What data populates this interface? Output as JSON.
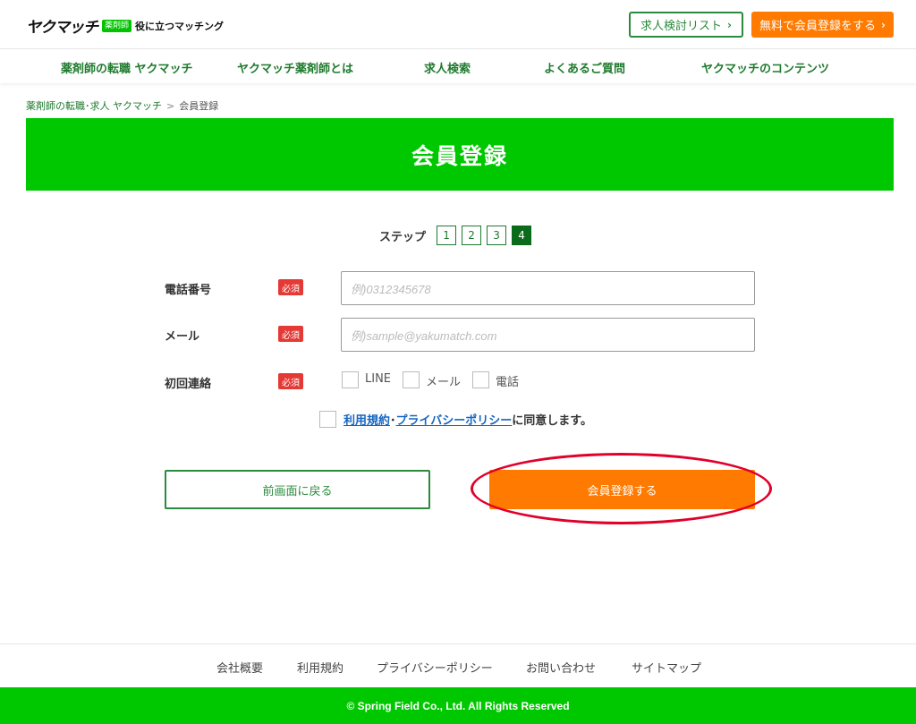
{
  "header": {
    "logo_main": "ヤクマッチ",
    "logo_badge": "薬剤師",
    "logo_tagline": "役に立つマッチング",
    "list_button": "求人検討リスト",
    "register_button": "無料で会員登録をする"
  },
  "nav": {
    "items": [
      {
        "label": "薬剤師の転職 ヤクマッチ"
      },
      {
        "label": "ヤクマッチ薬剤師とは"
      },
      {
        "label": "求人検索"
      },
      {
        "label": "よくあるご質問"
      },
      {
        "label": "ヤクマッチのコンテンツ"
      }
    ]
  },
  "breadcrumb": {
    "home": "薬剤師の転職･求人 ヤクマッチ",
    "separator": ">",
    "current": "会員登録"
  },
  "hero": {
    "title": "会員登録"
  },
  "steps": {
    "label": "ステップ",
    "items": [
      "1",
      "2",
      "3",
      "4"
    ],
    "current": "4"
  },
  "form": {
    "required_badge": "必須",
    "phone": {
      "label": "電話番号",
      "placeholder": "例)0312345678",
      "value": ""
    },
    "email": {
      "label": "メール",
      "placeholder": "例)sample@yakumatch.com",
      "value": ""
    },
    "first_contact": {
      "label": "初回連絡",
      "options": [
        {
          "label": "LINE",
          "checked": false
        },
        {
          "label": "メール",
          "checked": false
        },
        {
          "label": "電話",
          "checked": false
        }
      ]
    },
    "agree": {
      "checked": false,
      "terms_link": "利用規約",
      "dot": "･",
      "privacy_link": "プライバシーポリシー",
      "suffix": "に同意します。"
    },
    "back_button": "前画面に戻る",
    "submit_button": "会員登録する"
  },
  "footer": {
    "links": [
      {
        "label": "会社概要"
      },
      {
        "label": "利用規約"
      },
      {
        "label": "プライバシーポリシー"
      },
      {
        "label": "お問い合わせ"
      },
      {
        "label": "サイトマップ"
      }
    ],
    "copyright": "© Spring Field Co., Ltd. All Rights Reserved"
  },
  "colors": {
    "brand_green": "#00c800",
    "accent_orange": "#ff7a00",
    "required_red": "#e53935",
    "annotation_red": "#e0002a"
  }
}
